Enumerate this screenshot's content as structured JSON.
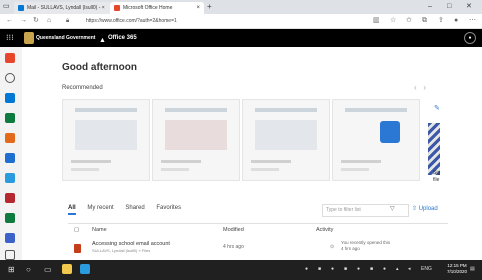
{
  "browser": {
    "tabs": [
      {
        "label": "Mail - SULLAVS, Lyndall (lsull0) - ×"
      },
      {
        "label": "Microsoft Office Home"
      }
    ],
    "tab_close": "×",
    "new_tab": "+",
    "url": "https://www.office.com/?auth=2&home=1",
    "window_controls": {
      "minimize": "–",
      "maximize": "□",
      "close": "✕"
    }
  },
  "suite": {
    "org": "Queensland Government",
    "app": "Office 365"
  },
  "main": {
    "greeting": "Good afternoon",
    "recommended_label": "Recommended",
    "sliver_text": "Sig\nfile",
    "filters": [
      "All",
      "My recent",
      "Shared",
      "Favorites"
    ],
    "filter_placeholder": "Type to filter list",
    "upload_label": "Upload",
    "columns": {
      "name": "Name",
      "modified": "Modified",
      "activity": "Activity"
    },
    "files": [
      {
        "name": "Accessing school email account",
        "sub": "SULLAVS, Lyndall (lsull0) » Files",
        "modified": "4 hrs ago",
        "activity": "You recently opened this\n4 hrs ago"
      }
    ]
  },
  "taskbar": {
    "time": "12:15 PM",
    "date": "7/10/2020",
    "lang": "ENG"
  },
  "colors": {
    "suite_bg": "#000000",
    "accent": "#2b78d4",
    "taskbar": "#202020"
  }
}
